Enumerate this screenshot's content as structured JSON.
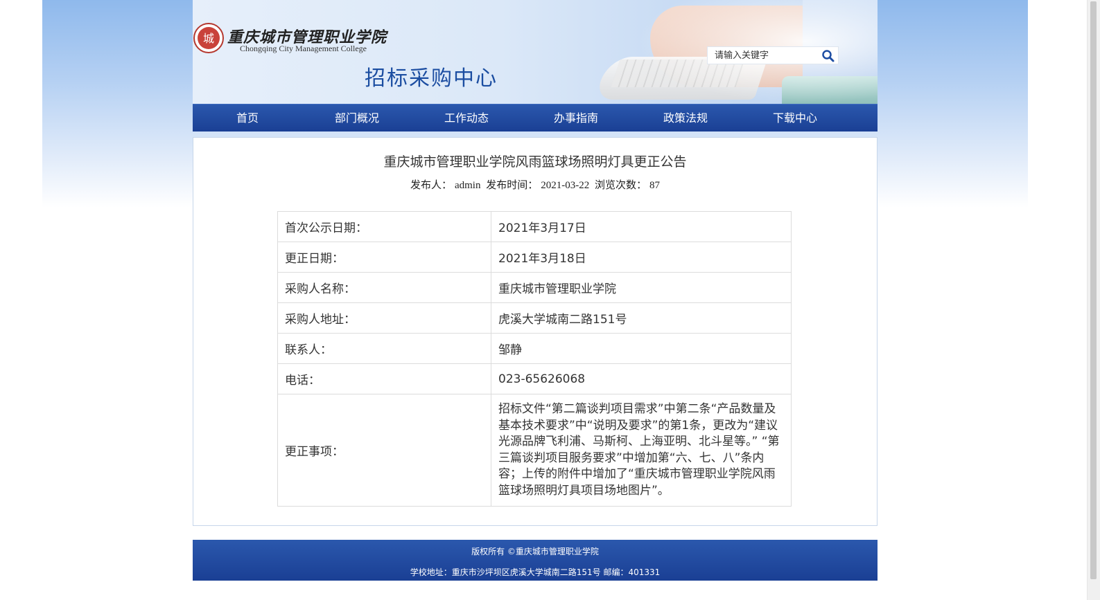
{
  "header": {
    "college_name_cn": "重庆城市管理职业学院",
    "college_name_en": "Chongqing City Management College",
    "logo_glyph": "城",
    "site_title": "招标采购中心",
    "search": {
      "placeholder": "请输入关键字",
      "icon": "search-icon"
    }
  },
  "nav": {
    "items": [
      {
        "label": "首页"
      },
      {
        "label": "部门概况"
      },
      {
        "label": "工作动态"
      },
      {
        "label": "办事指南"
      },
      {
        "label": "政策法规"
      },
      {
        "label": "下载中心"
      }
    ]
  },
  "article": {
    "title": "重庆城市管理职业学院风雨篮球场照明灯具更正公告",
    "meta": {
      "publisher_label": "发布人：",
      "publisher": "admin",
      "time_label": "发布时间：",
      "time": "2021-03-22",
      "views_label": "浏览次数：",
      "views": "87"
    },
    "rows": [
      {
        "key": "首次公示日期：",
        "value": "2021年3月17日"
      },
      {
        "key": "更正日期：",
        "value": "2021年3月18日"
      },
      {
        "key": "采购人名称：",
        "value": "重庆城市管理职业学院"
      },
      {
        "key": "采购人地址：",
        "value": "虎溪大学城南二路151号"
      },
      {
        "key": "联系人：",
        "value": "邹静"
      },
      {
        "key": "电话：",
        "value": "023-65626068"
      },
      {
        "key": "更正事项：",
        "value": "招标文件“第二篇谈判项目需求”中第二条“产品数量及基本技术要求”中“说明及要求”的第1条，更改为“建议光源品牌飞利浦、马斯柯、上海亚明、北斗星等。” “第三篇谈判项目服务要求”中增加第“六、七、八”条内容；上传的附件中增加了“重庆城市管理职业学院风雨篮球场照明灯具项目场地图片”。"
      }
    ]
  },
  "footer": {
    "copyright": "版权所有 ©重庆城市管理职业学院",
    "address": "学校地址：重庆市沙坪坝区虎溪大学城南二路151号 邮编：401331"
  },
  "colors": {
    "nav_bg": "#1f469c",
    "title_blue": "#1b4da1",
    "border": "#c6d6ea"
  }
}
